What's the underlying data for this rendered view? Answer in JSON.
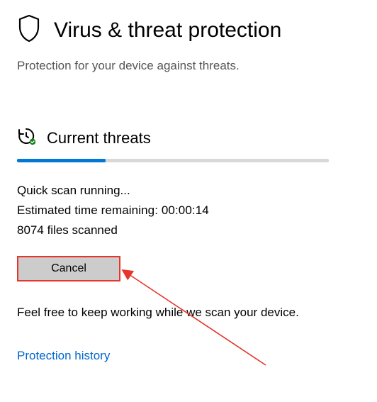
{
  "header": {
    "title": "Virus & threat protection",
    "subtitle": "Protection for your device against threats."
  },
  "section": {
    "title": "Current threats"
  },
  "scan": {
    "status": "Quick scan running...",
    "eta_label": "Estimated time remaining:",
    "eta_value": "00:00:14",
    "files_count": "8074",
    "files_suffix": "files scanned",
    "cancel_label": "Cancel",
    "hint": "Feel free to keep working while we scan your device."
  },
  "link": {
    "history": "Protection history"
  }
}
